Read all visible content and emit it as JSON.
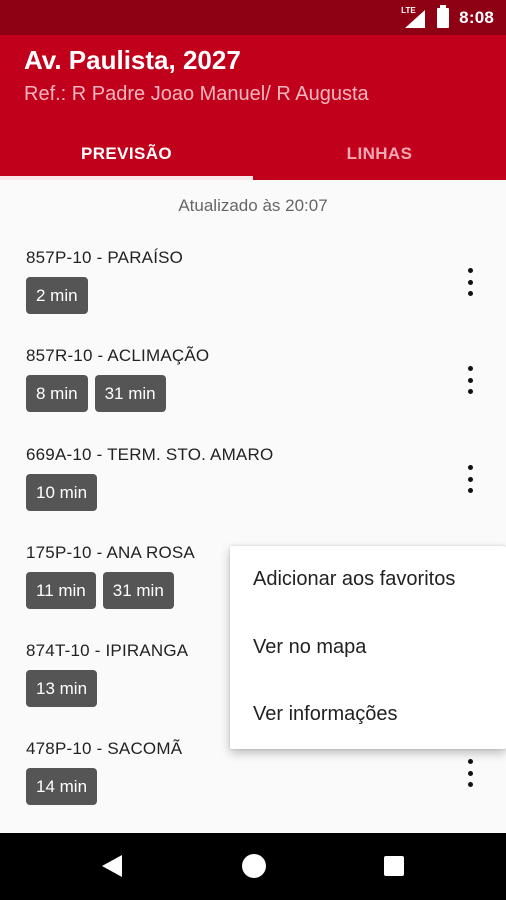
{
  "status_bar": {
    "network": "LTE",
    "time": "8:08"
  },
  "header": {
    "title": "Av. Paulista, 2027",
    "subtitle": "Ref.: R Padre Joao Manuel/ R Augusta"
  },
  "tabs": [
    {
      "label": "PREVISÃO",
      "selected": true
    },
    {
      "label": "LINHAS",
      "selected": false
    }
  ],
  "updated_text": "Atualizado às 20:07",
  "lines": [
    {
      "route": "857P-10 - PARAÍSO",
      "times": [
        "2 min"
      ]
    },
    {
      "route": "857R-10 - ACLIMAÇÃO",
      "times": [
        "8 min",
        "31 min"
      ]
    },
    {
      "route": "669A-10 - TERM. STO. AMARO",
      "times": [
        "10 min"
      ]
    },
    {
      "route": "175P-10 - ANA ROSA",
      "times": [
        "11 min",
        "31 min"
      ]
    },
    {
      "route": "874T-10 - IPIRANGA",
      "times": [
        "13 min"
      ]
    },
    {
      "route": "478P-10 - SACOMÃ",
      "times": [
        "14 min"
      ]
    }
  ],
  "context_menu": {
    "items": [
      "Adicionar aos favoritos",
      "Ver no mapa",
      "Ver informações"
    ]
  },
  "colors": {
    "primary": "#c1001b",
    "primary_dark": "#8e0014",
    "chip": "#555555"
  },
  "icons": {
    "more": "more-vert-icon",
    "back": "nav-back-icon",
    "home": "nav-home-icon",
    "recent": "nav-recents-icon"
  }
}
